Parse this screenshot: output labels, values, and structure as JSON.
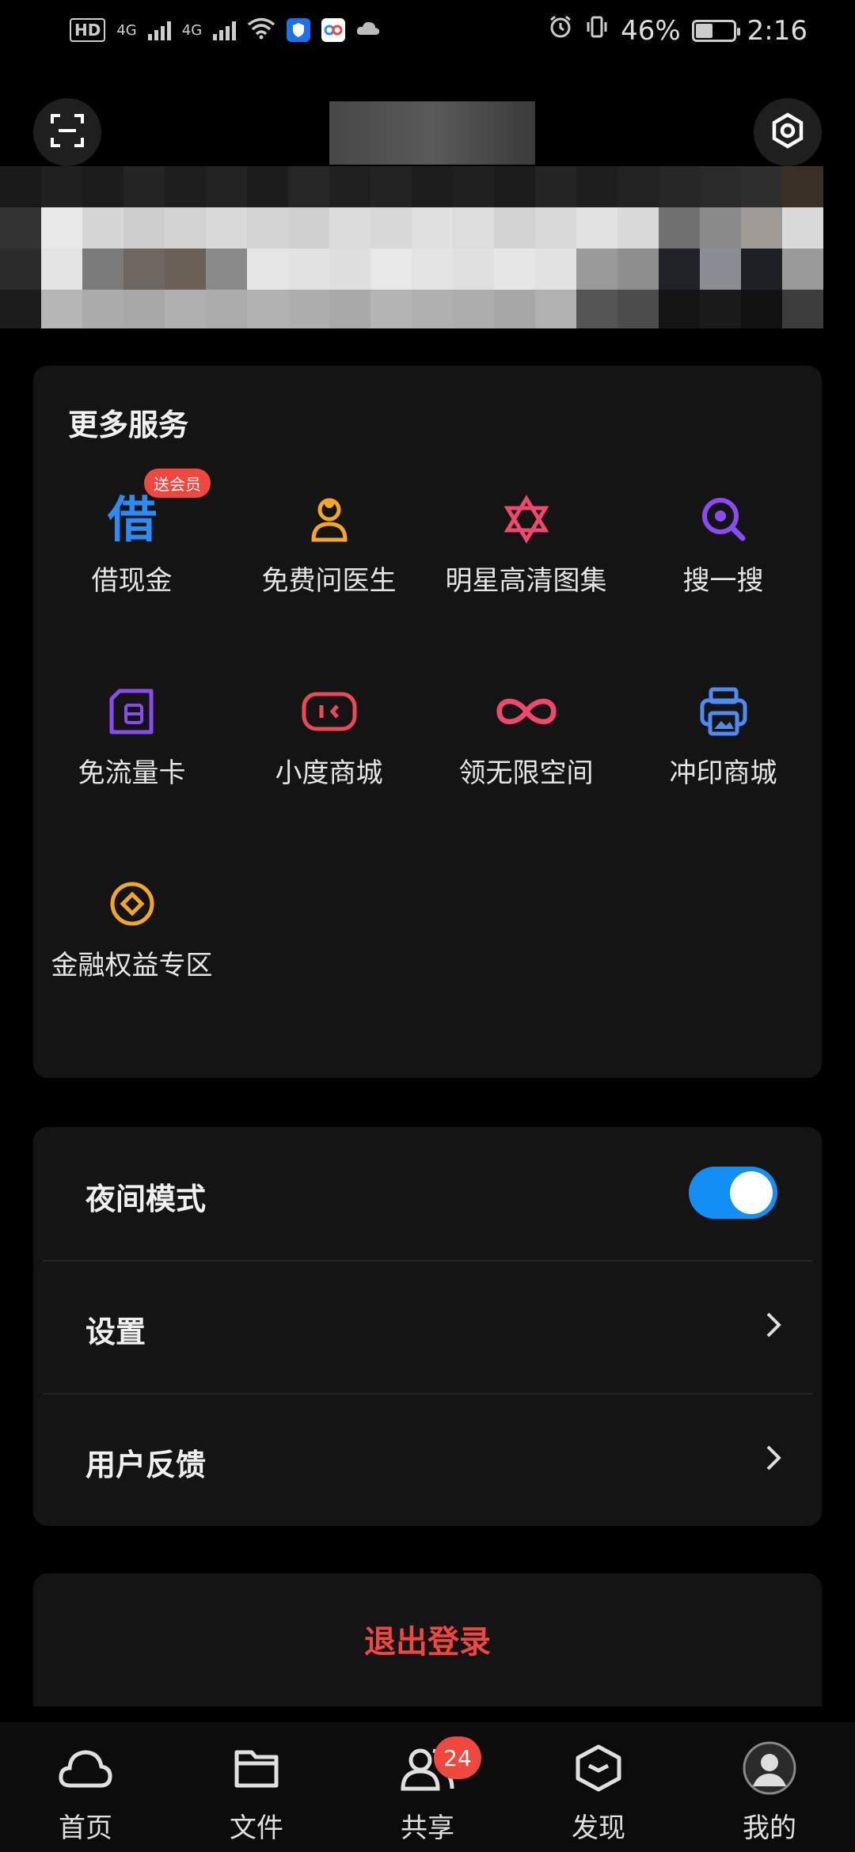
{
  "status_bar": {
    "hd_label": "HD",
    "net1": "4G",
    "net2": "4G",
    "battery_percent": "46%",
    "battery_level": 0.46,
    "time": "2:16"
  },
  "services": {
    "title": "更多服务",
    "vip_badge": "送会员",
    "items": [
      {
        "label": "借现金",
        "icon": "borrow-cash-icon"
      },
      {
        "label": "免费问医生",
        "icon": "doctor-icon"
      },
      {
        "label": "明星高清图集",
        "icon": "star-icon"
      },
      {
        "label": "搜一搜",
        "icon": "search-icon"
      },
      {
        "label": "免流量卡",
        "icon": "sim-card-icon"
      },
      {
        "label": "小度商城",
        "icon": "xiaodu-mall-icon"
      },
      {
        "label": "领无限空间",
        "icon": "infinity-icon"
      },
      {
        "label": "冲印商城",
        "icon": "print-mall-icon"
      },
      {
        "label": "金融权益专区",
        "icon": "finance-icon"
      }
    ]
  },
  "settings": {
    "night_mode_label": "夜间模式",
    "night_mode_on": true,
    "settings_label": "设置",
    "feedback_label": "用户反馈"
  },
  "logout_label": "退出登录",
  "bottom_nav": {
    "items": [
      {
        "label": "首页",
        "icon": "cloud-icon"
      },
      {
        "label": "文件",
        "icon": "folder-icon"
      },
      {
        "label": "共享",
        "icon": "people-icon",
        "badge": "24"
      },
      {
        "label": "发现",
        "icon": "box-icon"
      },
      {
        "label": "我的",
        "icon": "avatar-icon"
      }
    ]
  },
  "colors": {
    "accent_blue": "#118ff5",
    "logout_red": "#f0473f",
    "card_bg": "#141414"
  }
}
